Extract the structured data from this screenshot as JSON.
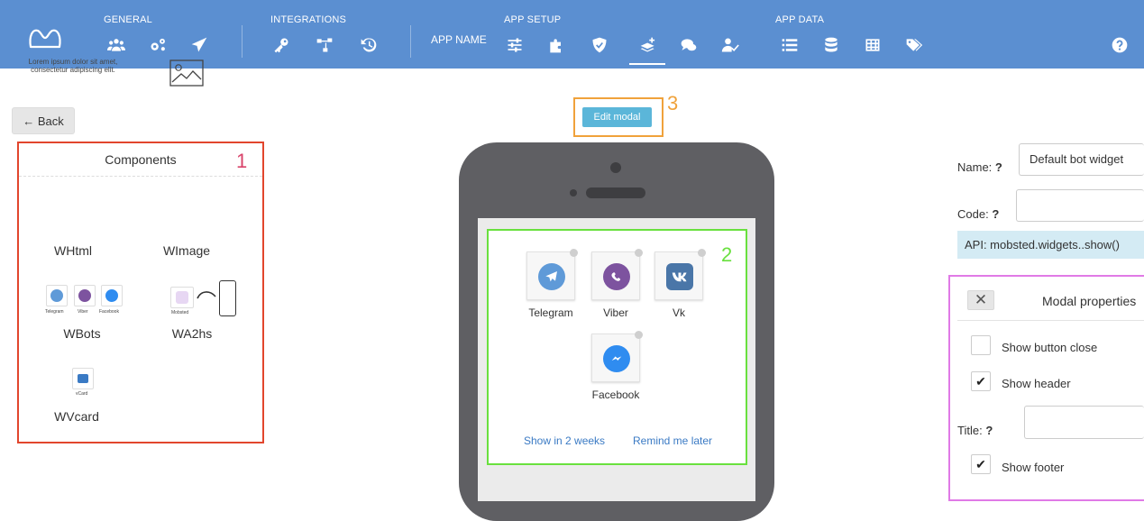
{
  "nav": {
    "sections": [
      "GENERAL",
      "INTEGRATIONS",
      "APP SETUP",
      "APP DATA"
    ],
    "app_name": "APP NAME",
    "accent": "#5b8fd1",
    "icons": [
      "logo-icon",
      "users-icon",
      "gears-icon",
      "send-icon",
      "key-icon",
      "network-icon",
      "history-icon",
      "sliders-icon",
      "puzzle-icon",
      "shield-icon",
      "layers-plus-icon",
      "chat-icon",
      "user-check-icon",
      "list-icon",
      "database-icon",
      "table-icon",
      "tags-icon",
      "help-icon"
    ]
  },
  "back_label": "← Back",
  "components": {
    "title": "Components",
    "number": "1",
    "lorem": "Lorem ipsum dolor sit amet, consectetur adipiscing elit.",
    "items": [
      {
        "name": "WHtml"
      },
      {
        "name": "WImage"
      },
      {
        "name": "WBots",
        "captions": [
          "Telegram",
          "Viber",
          "Facebook"
        ]
      },
      {
        "name": "WA2hs",
        "caption": "Mobsted"
      },
      {
        "name": "WVcard",
        "caption": "vCard"
      }
    ]
  },
  "edit_modal": {
    "label": "Edit modal",
    "number": "3"
  },
  "preview": {
    "number": "2",
    "bots": [
      {
        "label": "Telegram",
        "color": "#5f9ad8"
      },
      {
        "label": "Viber",
        "color": "#7d539f"
      },
      {
        "label": "Vk",
        "color": "#4a76a8"
      },
      {
        "label": "Facebook",
        "color": "#2f8cf0"
      }
    ],
    "links": [
      "Show in 2 weeks",
      "Remind me later"
    ]
  },
  "form": {
    "name_label": "Name:",
    "name_value": "Default bot widget",
    "code_label": "Code:",
    "code_value": "",
    "help_mark": "?",
    "api_text": "API: mobsted.widgets..show()",
    "title_label": "Title:",
    "title_value": ""
  },
  "modal_props": {
    "title": "Modal properties",
    "close_glyph": "✕",
    "options": [
      {
        "label": "Show button close",
        "checked": false
      },
      {
        "label": "Show header",
        "checked": true
      },
      {
        "label": "Show footer",
        "checked": true
      }
    ]
  },
  "annotation_colors": {
    "components": "#e2462d",
    "preview": "#69e03e",
    "edit": "#f0a23b",
    "props": "#e07ae6"
  }
}
